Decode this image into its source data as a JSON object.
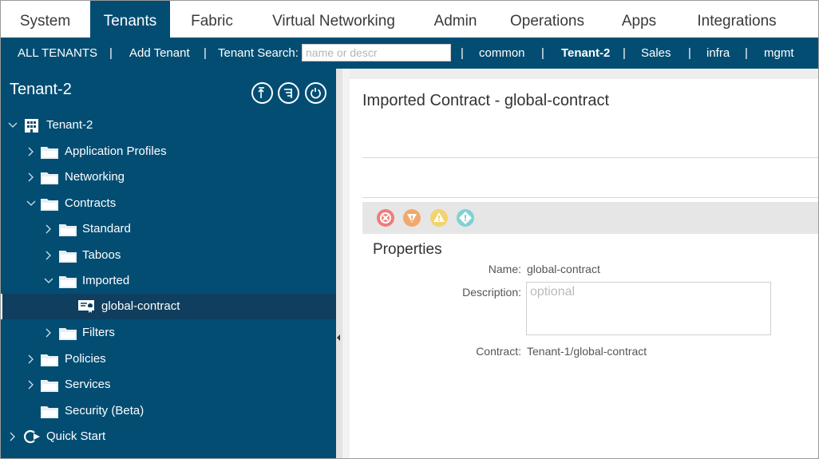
{
  "top_nav": {
    "tabs": [
      {
        "label": "System"
      },
      {
        "label": "Tenants"
      },
      {
        "label": "Fabric"
      },
      {
        "label": "Virtual Networking"
      },
      {
        "label": "Admin"
      },
      {
        "label": "Operations"
      },
      {
        "label": "Apps"
      },
      {
        "label": "Integrations"
      }
    ],
    "active_tab": "Tenants"
  },
  "sub_bar": {
    "all_tenants": "ALL TENANTS",
    "add_tenant": "Add Tenant",
    "search_label": "Tenant Search:",
    "search_placeholder": "name or descr",
    "separator": "|",
    "tenants": [
      "common",
      "Tenant-2",
      "Sales",
      "infra",
      "mgmt"
    ],
    "current_tenant": "Tenant-2"
  },
  "sidebar": {
    "title": "Tenant-2",
    "tree": [
      {
        "label": "Tenant-2",
        "expanded": true,
        "icon": "building-icon"
      },
      {
        "label": "Application Profiles",
        "expanded": false,
        "icon": "folder-icon"
      },
      {
        "label": "Networking",
        "expanded": false,
        "icon": "folder-icon"
      },
      {
        "label": "Contracts",
        "expanded": true,
        "icon": "folder-icon"
      },
      {
        "label": "Standard",
        "expanded": false,
        "icon": "folder-icon"
      },
      {
        "label": "Taboos",
        "expanded": false,
        "icon": "folder-icon"
      },
      {
        "label": "Imported",
        "expanded": true,
        "icon": "folder-icon"
      },
      {
        "label": "global-contract",
        "selected": true,
        "icon": "contract-icon"
      },
      {
        "label": "Filters",
        "expanded": false,
        "icon": "folder-icon"
      },
      {
        "label": "Policies",
        "expanded": false,
        "icon": "folder-icon"
      },
      {
        "label": "Services",
        "expanded": false,
        "icon": "folder-icon"
      },
      {
        "label": "Security (Beta)",
        "icon": "folder-icon"
      },
      {
        "label": "Quick Start",
        "expanded": false,
        "icon": "quick-start-icon"
      }
    ]
  },
  "content": {
    "title": "Imported Contract - global-contract",
    "fault_icons": [
      "critical-fault-icon",
      "major-fault-icon",
      "minor-fault-icon",
      "warning-fault-icon"
    ],
    "properties": {
      "heading": "Properties",
      "name_label": "Name:",
      "name_value": "global-contract",
      "description_label": "Description:",
      "description_placeholder": "optional",
      "contract_label": "Contract:",
      "contract_value": "Tenant-1/global-contract"
    }
  },
  "colors": {
    "nav_blue": "#034d73",
    "selected_row": "#0f3e5e",
    "fault_critical": "#ee7c7c",
    "fault_major": "#f2a86a",
    "fault_minor": "#f3d36e",
    "fault_warning": "#7fd1d4"
  }
}
